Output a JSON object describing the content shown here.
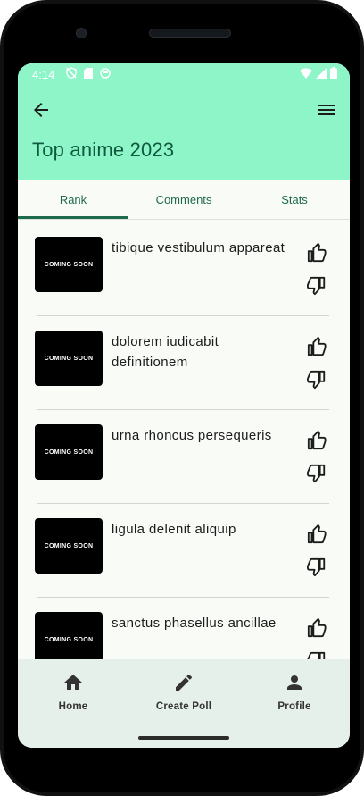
{
  "status_bar": {
    "time": "4:14",
    "icons_left": [
      "shield-off-icon",
      "sd-card-icon",
      "face-icon"
    ],
    "icons_right": [
      "wifi-icon",
      "signal-icon",
      "battery-icon"
    ]
  },
  "header": {
    "title": "Top anime 2023",
    "background": "#8ef5c9",
    "title_color": "#0e5a3e"
  },
  "tabs": [
    {
      "label": "Rank",
      "active": true
    },
    {
      "label": "Comments",
      "active": false
    },
    {
      "label": "Stats",
      "active": false
    }
  ],
  "items": [
    {
      "thumb_label": "COMING SOON",
      "title": "tibique vestibulum appareat"
    },
    {
      "thumb_label": "COMING SOON",
      "title": "dolorem iudicabit definitionem"
    },
    {
      "thumb_label": "COMING SOON",
      "title": "urna rhoncus persequeris"
    },
    {
      "thumb_label": "COMING SOON",
      "title": "ligula delenit aliquip"
    },
    {
      "thumb_label": "COMING SOON",
      "title": "sanctus phasellus ancillae"
    }
  ],
  "bottom_nav": [
    {
      "label": "Home",
      "icon": "home-icon"
    },
    {
      "label": "Create Poll",
      "icon": "pencil-icon"
    },
    {
      "label": "Profile",
      "icon": "person-icon"
    }
  ],
  "colors": {
    "accent": "#1e6a4d",
    "screen_bg": "#f9fbf7",
    "nav_bg": "#e6f0ea"
  }
}
